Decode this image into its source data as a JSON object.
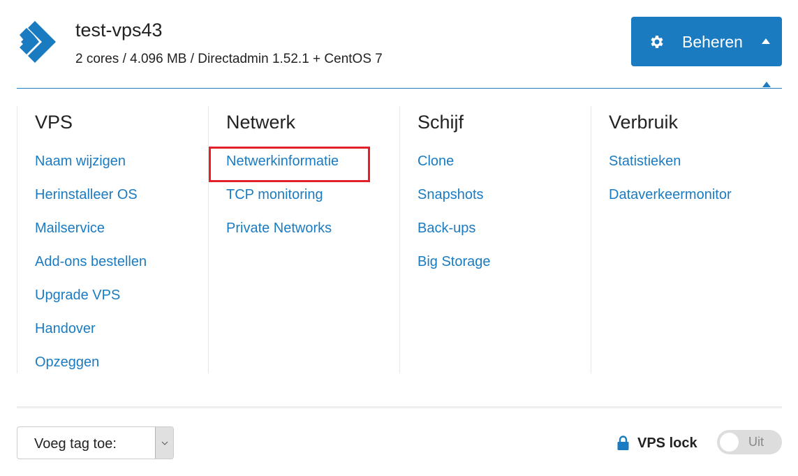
{
  "header": {
    "title": "test-vps43",
    "subtitle": "2 cores / 4.096 MB / Directadmin 1.52.1 + CentOS 7",
    "logo_icon": "double-chevron-right-logo",
    "manage_button": {
      "label": "Beheren",
      "icon": "gear-icon",
      "caret": "caret-up-icon"
    }
  },
  "colors": {
    "accent": "#1b7bc1",
    "highlight": "#e3202a",
    "toggle_off": "#dddddd"
  },
  "menu": {
    "columns": [
      {
        "title": "VPS",
        "items": [
          "Naam wijzigen",
          "Herinstalleer OS",
          "Mailservice",
          "Add-ons bestellen",
          "Upgrade VPS",
          "Handover",
          "Opzeggen"
        ]
      },
      {
        "title": "Netwerk",
        "items": [
          "Netwerkinformatie",
          "TCP monitoring",
          "Private Networks"
        ],
        "highlighted_item": "Netwerkinformatie"
      },
      {
        "title": "Schijf",
        "items": [
          "Clone",
          "Snapshots",
          "Back-ups",
          "Big Storage"
        ]
      },
      {
        "title": "Verbruik",
        "items": [
          "Statistieken",
          "Dataverkeermonitor"
        ]
      }
    ]
  },
  "footer": {
    "tag_select": {
      "value": "Voeg tag toe:"
    },
    "vps_lock": {
      "label": "VPS lock",
      "icon": "lock-icon",
      "state": "off",
      "toggle_text": "Uit"
    }
  }
}
